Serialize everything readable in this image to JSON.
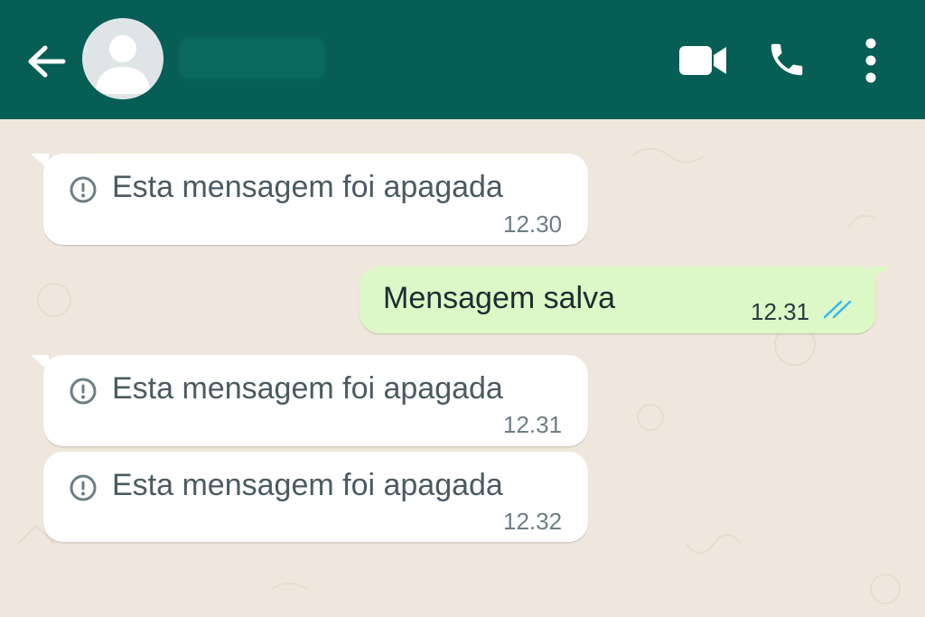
{
  "header": {
    "back_icon": "arrow-left-icon",
    "avatar_icon": "default-user-icon",
    "contact_name": "",
    "actions": [
      {
        "name": "video-call",
        "icon": "video-camera-icon"
      },
      {
        "name": "voice-call",
        "icon": "phone-icon"
      },
      {
        "name": "more-options",
        "icon": "more-vertical-icon"
      }
    ]
  },
  "messages": [
    {
      "direction": "incoming",
      "deleted": true,
      "text": "Esta mensagem foi apagada",
      "time": "12.30",
      "icon": "info-circle-icon"
    },
    {
      "direction": "outgoing",
      "deleted": false,
      "text": "Mensagem salva",
      "time": "12.31",
      "status": "read",
      "status_icon": "double-check-icon"
    },
    {
      "direction": "incoming",
      "deleted": true,
      "text": "Esta mensagem foi apagada",
      "time": "12.31",
      "icon": "info-circle-icon"
    },
    {
      "direction": "incoming",
      "deleted": true,
      "text": "Esta mensagem foi apagada",
      "time": "12.32",
      "icon": "info-circle-icon"
    }
  ],
  "colors": {
    "header_bg": "#075e54",
    "chat_bg": "#efe7dd",
    "incoming_bubble": "#ffffff",
    "outgoing_bubble": "#dcf8c6",
    "read_ticks": "#34b7f1"
  }
}
